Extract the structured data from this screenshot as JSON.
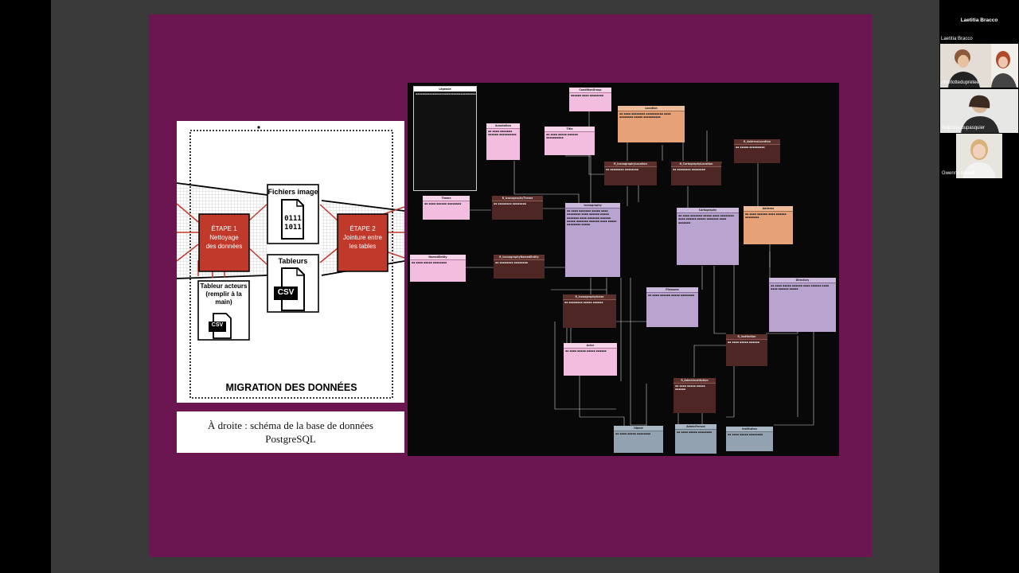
{
  "slide": {
    "diagram": {
      "fichiers_image": "Fichiers image",
      "binary_top": "0111",
      "binary_bottom": "1011",
      "tableurs": "Tableurs",
      "csv_large": "CSV",
      "etape1_line1": "ÉTAPE 1",
      "etape1_line2": "Nettoyage",
      "etape1_line3": "des données",
      "etape2_line1": "ÉTAPE 2",
      "etape2_line2": "Jointure entre",
      "etape2_line3": "les tables",
      "tableur_acteurs_line1": "Tableur acteurs",
      "tableur_acteurs_line2": "(remplir à la",
      "tableur_acteurs_line3": "main)",
      "csv_small": "CSV",
      "title": "MIGRATION DES DONNÉES"
    },
    "caption_line1": "À droite : schéma de la base de données",
    "caption_line2": "PostgreSQL",
    "erd": {
      "legend_title": "Légende",
      "entities": {
        "conditionsgroup": "ConditionGroup",
        "location": "Location",
        "annotation": "Annotation",
        "title": "Title",
        "r_addresslocation": "R_AddressLocation",
        "r_iconographylocation": "R_IconographyLocation",
        "r_cartographylocation": "R_CartographyLocation",
        "theme": "Theme",
        "r_iconographytheme": "R_IconographyTheme",
        "iconography": "Iconography",
        "cartography": "Cartography",
        "address": "Address",
        "namedentity": "NamedEntity",
        "r_iconographynamedentity": "R_IconographyNamedEntity",
        "directory": "Directory",
        "filename": "Filename",
        "r_iconographyactor": "R_IconographyActor",
        "r_institution": "R_Institution",
        "actor": "Actor",
        "r_admininstitution": "R_AdminInstitution",
        "object": "Object",
        "admin_person": "AdminPerson",
        "institution": "Institution"
      }
    }
  },
  "participants": {
    "active_speaker": "Laetitia Bracco",
    "label_active": "Laetitia Bracco",
    "p1": "charlottedupretee",
    "p2": "delphine.dupasquier",
    "p3": "Gwenna Briand"
  },
  "colors": {
    "slide_background": "#6b1650",
    "step_box": "#c0392b",
    "entity_pink": "#f3bde0",
    "entity_lavender": "#b9a3cf",
    "entity_orange": "#e6a276",
    "entity_brown": "#4e2724",
    "entity_grey": "#93a2b0"
  }
}
